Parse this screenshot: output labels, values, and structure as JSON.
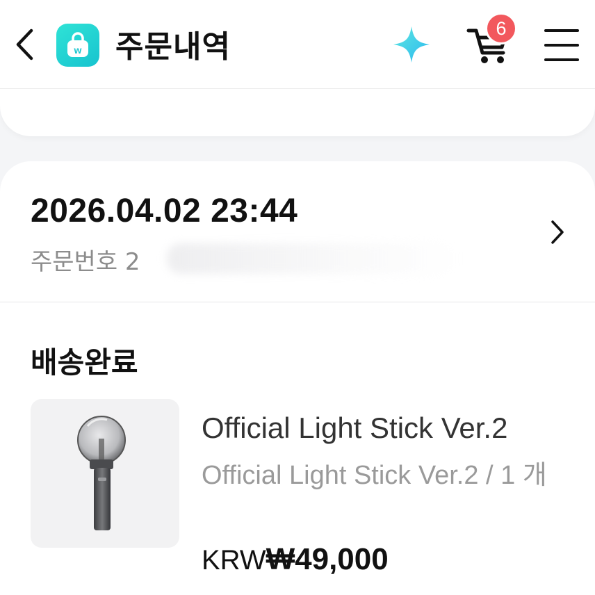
{
  "header": {
    "title": "주문내역",
    "back_icon": "chevron-left-icon",
    "logo_icon": "shopping-bag-icon",
    "sparkle_icon": "sparkle-icon",
    "cart_icon": "cart-icon",
    "cart_count": "6",
    "menu_icon": "hamburger-menu-icon",
    "colors": {
      "logo": "#1fd3d2",
      "badge": "#f2585d",
      "sparkle": "#34d7ea"
    }
  },
  "order": {
    "date": "2026.04.02 23:44",
    "number_label": "주문번호 2",
    "status": "배송완료",
    "product": {
      "name": "Official Light Stick Ver.2",
      "option": "Official Light Stick Ver.2 / 1 개",
      "price_currency": "KRW",
      "price_amount": "₩49,000"
    }
  }
}
